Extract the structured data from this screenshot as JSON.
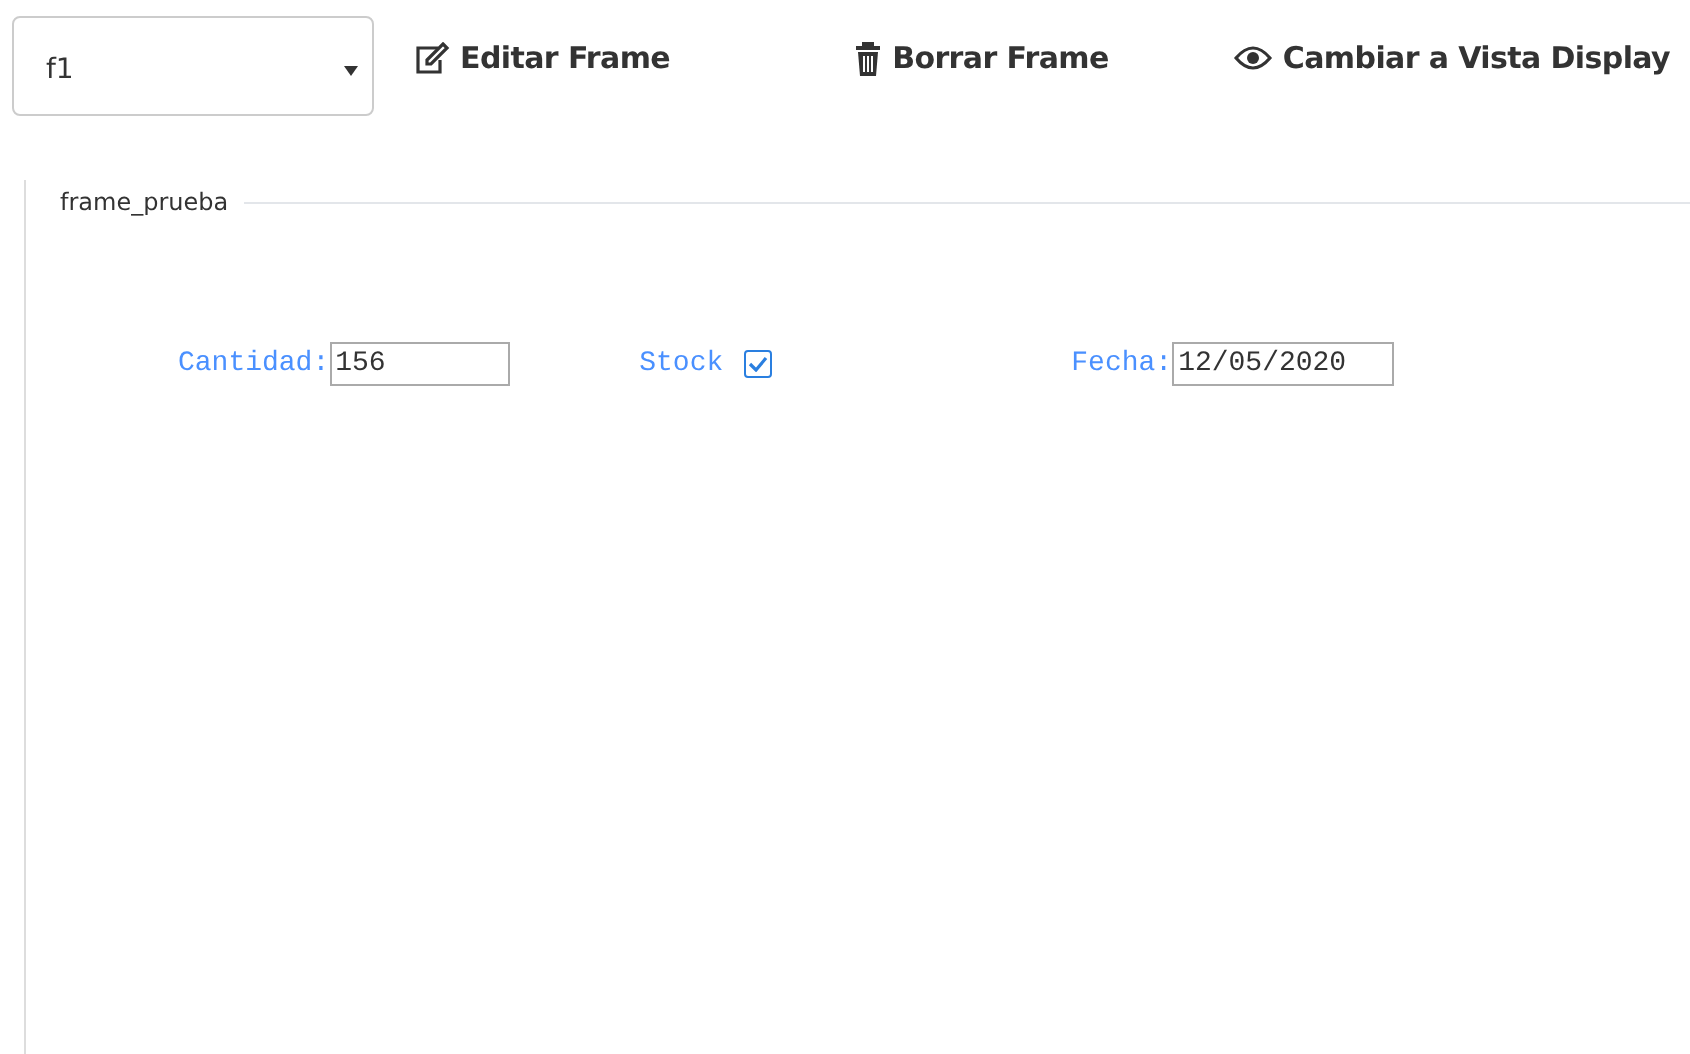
{
  "frame_select": {
    "value": "f1"
  },
  "actions": [
    {
      "kind": "edit",
      "label": "Editar Frame"
    },
    {
      "kind": "delete",
      "label": "Borrar Frame"
    },
    {
      "kind": "view",
      "label": "Cambiar a Vista Display"
    }
  ],
  "frame": {
    "legend": "frame_prueba",
    "fields": [
      {
        "kind": "text",
        "label": "Cantidad:",
        "value": "156"
      },
      {
        "kind": "checkbox",
        "label": "Stock",
        "checked": true
      },
      {
        "kind": "text",
        "label": "Fecha:",
        "value": "12/05/2020"
      }
    ]
  }
}
